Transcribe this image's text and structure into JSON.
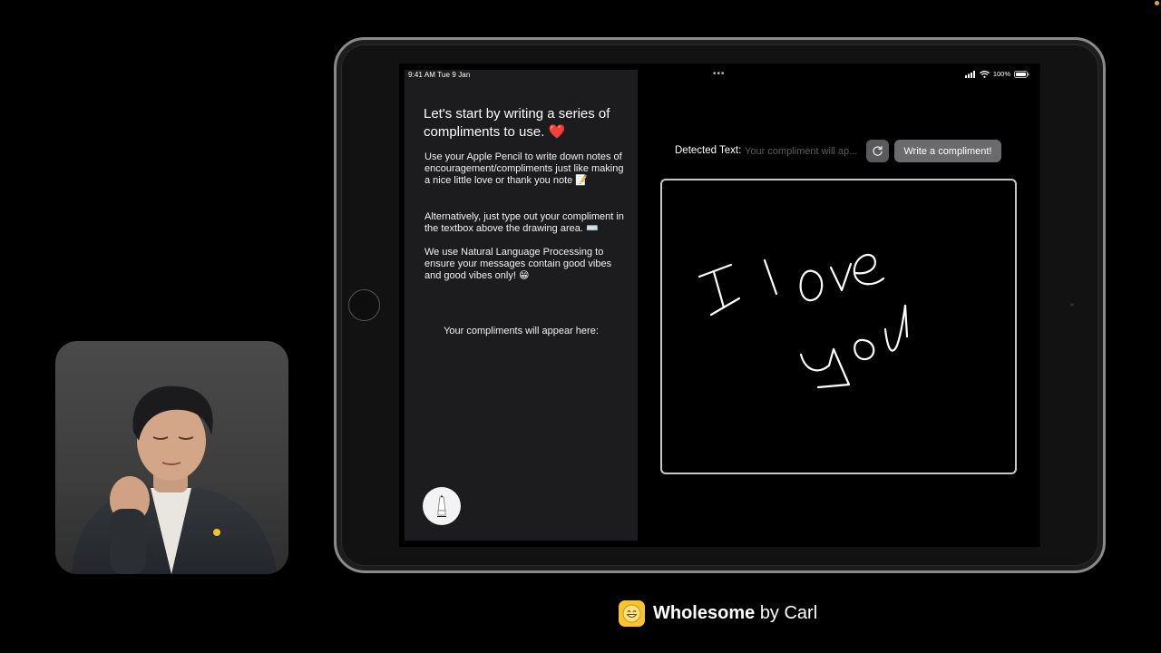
{
  "status_bar": {
    "time": "9:41 AM  Tue 9 Jan",
    "battery": "100%"
  },
  "left_panel": {
    "title": "Let's start by writing a series of compliments to use. ❤️",
    "paragraph_1": "Use your Apple Pencil to write down notes of encouragement/compliments just like making a nice little love or thank you note 📝",
    "paragraph_2": "Alternatively, just type out your compliment in the textbox above the drawing area. ⌨️",
    "paragraph_3": "We use Natural Language Processing to ensure your messages contain good vibes and good vibes only! 😁",
    "compliments_label": "Your compliments will appear here:"
  },
  "toolbar": {
    "detected_label": "Detected Text:",
    "detected_placeholder": "Your compliment will ap...",
    "write_button_label": "Write a compliment!"
  },
  "canvas": {
    "handwriting": "I love you"
  },
  "brand": {
    "name": "Wholesome",
    "byline": "by Carl"
  },
  "icons": {
    "refresh": "refresh-icon",
    "pencil": "pencil-icon",
    "wifi": "wifi-icon",
    "signal": "signal-icon",
    "battery": "battery-icon",
    "app": "grinning-face-icon"
  },
  "colors": {
    "brand_yellow": "#f7c531",
    "button_gray": "#6b6b6d",
    "panel_bg": "#1c1c1e"
  }
}
